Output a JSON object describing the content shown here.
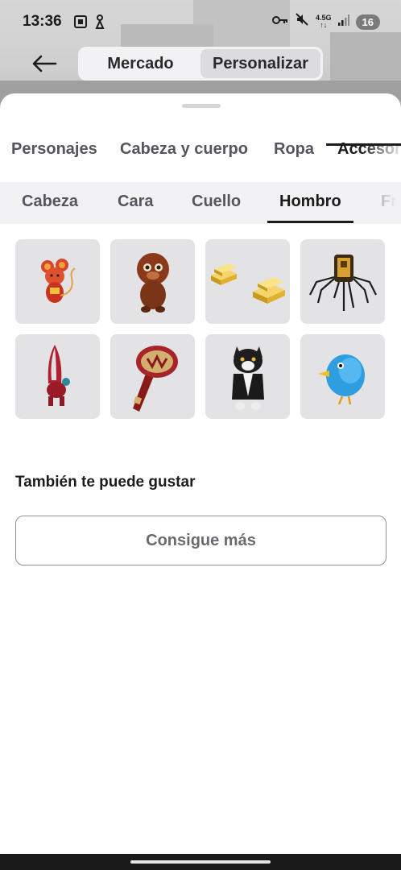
{
  "status_bar": {
    "time": "13:36",
    "network_top": "4.5G",
    "network_bottom": "↑↓",
    "battery": "16"
  },
  "header": {
    "segments": [
      {
        "label": "Mercado",
        "active": false
      },
      {
        "label": "Personalizar",
        "active": true
      }
    ]
  },
  "main_tabs": [
    {
      "label": "Personajes",
      "active": false
    },
    {
      "label": "Cabeza y cuerpo",
      "active": false
    },
    {
      "label": "Ropa",
      "active": false
    },
    {
      "label": "Accesor",
      "active": true
    }
  ],
  "sub_tabs": [
    {
      "label": "Cabeza",
      "active": false
    },
    {
      "label": "Cara",
      "active": false
    },
    {
      "label": "Cuello",
      "active": false
    },
    {
      "label": "Hombro",
      "active": true
    },
    {
      "label": "Fr",
      "active": false
    }
  ],
  "items": [
    {
      "icon": "red-mouse-icon"
    },
    {
      "icon": "brown-monkey-icon"
    },
    {
      "icon": "gold-bars-icon"
    },
    {
      "icon": "spider-robot-icon"
    },
    {
      "icon": "red-rocket-icon"
    },
    {
      "icon": "championship-belt-icon"
    },
    {
      "icon": "tuxedo-cat-icon"
    },
    {
      "icon": "blue-bird-icon"
    }
  ],
  "recommendations": {
    "title": "También te puede gustar",
    "button_label": "Consigue más"
  },
  "colors": {
    "sheet_bg": "#ffffff",
    "tile_bg": "#e3e3e6",
    "subtab_bg": "#f2f2f4",
    "text_primary": "#1c1c1c",
    "text_secondary": "#55555e"
  }
}
